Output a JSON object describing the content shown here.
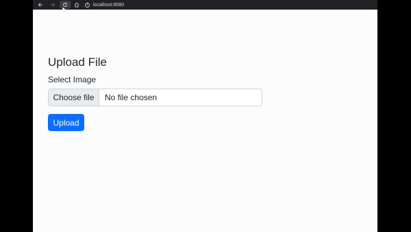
{
  "browser": {
    "back_icon": "arrow-left-icon",
    "forward_icon": "arrow-right-icon",
    "reload_icon": "reload-icon",
    "home_icon": "home-icon",
    "info_icon": "info-icon",
    "url": "localhost:8080"
  },
  "page": {
    "title": "Upload File",
    "field_label": "Select Image",
    "file_input": {
      "button_label": "Choose file",
      "status_text": "No file chosen"
    },
    "upload_button_label": "Upload"
  },
  "colors": {
    "toolbar_bg": "#202124",
    "page_bg": "#fcfcfd",
    "primary": "#0d6efd",
    "file_button_bg": "#e9ecef",
    "border": "#ced4da",
    "text": "#212529"
  }
}
